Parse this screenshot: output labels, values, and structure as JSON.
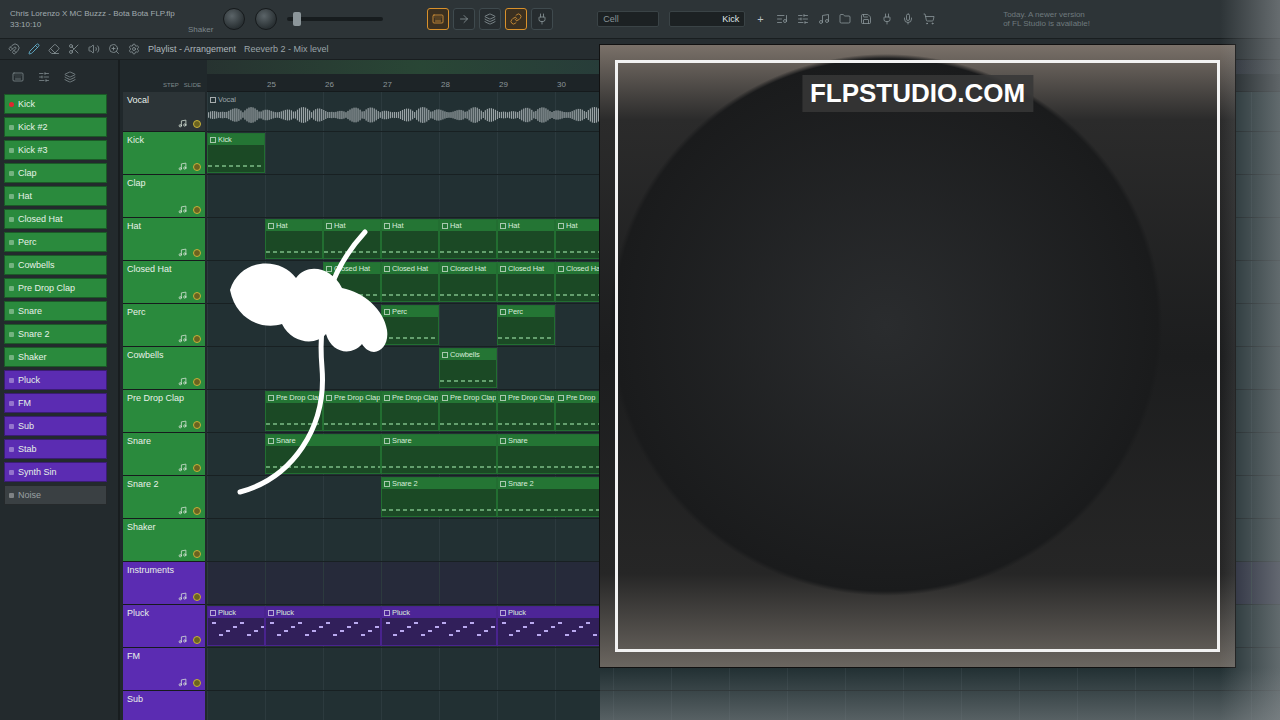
{
  "toolbar": {
    "project_title": "Chris Lorenzo X MC Buzzz - Bota Bota FLP.flp",
    "time": "33:10:10",
    "hint": "Shaker",
    "cell_label": "Cell",
    "pattern": "Kick",
    "add": "+",
    "update_notice": [
      "Today. A newer version",
      "of FL Studio is available!"
    ]
  },
  "playlist_bar": {
    "title": "Playlist - Arrangement",
    "target": "Reeverb 2 - Mix level"
  },
  "snap": {
    "step": "STEP",
    "slide": "SLIDE"
  },
  "channels": [
    {
      "name": "Kick",
      "selected": true,
      "disabled": false,
      "color": "#2a8a3d"
    },
    {
      "name": "Kick #2",
      "selected": false,
      "disabled": false,
      "color": "#2a8a3d"
    },
    {
      "name": "Kick #3",
      "selected": false,
      "disabled": false,
      "color": "#2a8a3d"
    },
    {
      "name": "Clap",
      "selected": false,
      "disabled": false,
      "color": "#2a8a3d"
    },
    {
      "name": "Hat",
      "selected": false,
      "disabled": false,
      "color": "#2a8a3d"
    },
    {
      "name": "Closed Hat",
      "selected": false,
      "disabled": false,
      "color": "#2a8a3d"
    },
    {
      "name": "Perc",
      "selected": false,
      "disabled": false,
      "color": "#2a8a3d"
    },
    {
      "name": "Cowbells",
      "selected": false,
      "disabled": false,
      "color": "#2a8a3d"
    },
    {
      "name": "Pre Drop Clap",
      "selected": false,
      "disabled": false,
      "color": "#2a8a3d"
    },
    {
      "name": "Snare",
      "selected": false,
      "disabled": false,
      "color": "#2a8a3d"
    },
    {
      "name": "Snare  2",
      "selected": false,
      "disabled": false,
      "color": "#2a8a3d"
    },
    {
      "name": "Shaker",
      "selected": false,
      "disabled": false,
      "color": "#2a8a3d"
    },
    {
      "name": "Pluck",
      "selected": false,
      "disabled": false,
      "color": "#5b2cb2"
    },
    {
      "name": "FM",
      "selected": false,
      "disabled": false,
      "color": "#5b2cb2"
    },
    {
      "name": "Sub",
      "selected": false,
      "disabled": false,
      "color": "#5b2cb2"
    },
    {
      "name": "Stab",
      "selected": false,
      "disabled": false,
      "color": "#5b2cb2"
    },
    {
      "name": "Synth Sin",
      "selected": false,
      "disabled": false,
      "color": "#5b2cb2"
    },
    {
      "name": "Noise",
      "selected": false,
      "disabled": true,
      "color": "#3a4043"
    }
  ],
  "ruler": [
    "25",
    "26",
    "27",
    "28",
    "29",
    "30"
  ],
  "tracks": [
    {
      "name": "Vocal",
      "kind": "audio",
      "color": "#2c3437",
      "clips": [
        {
          "label": "Vocal",
          "start": 0,
          "length": 7
        }
      ]
    },
    {
      "name": "Kick",
      "kind": "pattern",
      "color": "#2a8a3d",
      "clips": [
        {
          "label": "Kick",
          "start": 0,
          "length": 1
        }
      ]
    },
    {
      "name": "Clap",
      "kind": "pattern",
      "color": "#2a8a3d",
      "clips": []
    },
    {
      "name": "Hat",
      "kind": "pattern",
      "color": "#2a8a3d",
      "clips": [
        {
          "label": "Hat",
          "start": 1,
          "length": 1
        },
        {
          "label": "Hat",
          "start": 2,
          "length": 1
        },
        {
          "label": "Hat",
          "start": 3,
          "length": 1
        },
        {
          "label": "Hat",
          "start": 4,
          "length": 1
        },
        {
          "label": "Hat",
          "start": 5,
          "length": 1
        },
        {
          "label": "Hat",
          "start": 6,
          "length": 1
        }
      ]
    },
    {
      "name": "Closed Hat",
      "kind": "pattern",
      "color": "#2a8a3d",
      "clips": [
        {
          "label": "Closed Hat",
          "start": 2,
          "length": 1
        },
        {
          "label": "Closed Hat",
          "start": 3,
          "length": 1
        },
        {
          "label": "Closed Hat",
          "start": 4,
          "length": 1
        },
        {
          "label": "Closed Hat",
          "start": 5,
          "length": 1
        },
        {
          "label": "Closed Hat",
          "start": 6,
          "length": 1
        }
      ]
    },
    {
      "name": "Perc",
      "kind": "pattern",
      "color": "#2a8a3d",
      "clips": [
        {
          "label": "Perc",
          "start": 3,
          "length": 1
        },
        {
          "label": "Perc",
          "start": 5,
          "length": 1
        }
      ]
    },
    {
      "name": "Cowbells",
      "kind": "pattern",
      "color": "#2a8a3d",
      "clips": [
        {
          "label": "Cowbells",
          "start": 4,
          "length": 1
        }
      ]
    },
    {
      "name": "Pre Drop Clap",
      "kind": "pattern",
      "color": "#2a8a3d",
      "clips": [
        {
          "label": "Pre Drop Clap",
          "start": 1,
          "length": 1
        },
        {
          "label": "Pre Drop Clap",
          "start": 2,
          "length": 1
        },
        {
          "label": "Pre Drop Clap",
          "start": 3,
          "length": 1
        },
        {
          "label": "Pre Drop Clap",
          "start": 4,
          "length": 1
        },
        {
          "label": "Pre Drop Clap",
          "start": 5,
          "length": 1
        },
        {
          "label": "Pre Drop",
          "start": 6,
          "length": 1
        }
      ]
    },
    {
      "name": "Snare",
      "kind": "pattern",
      "color": "#2a8a3d",
      "clips": [
        {
          "label": "Snare",
          "start": 1,
          "length": 2
        },
        {
          "label": "Snare",
          "start": 3,
          "length": 2
        },
        {
          "label": "Snare",
          "start": 5,
          "length": 2
        }
      ]
    },
    {
      "name": "Snare  2",
      "kind": "pattern",
      "color": "#2a8a3d",
      "clips": [
        {
          "label": "Snare  2",
          "start": 3,
          "length": 2
        },
        {
          "label": "Snare  2",
          "start": 5,
          "length": 2
        }
      ]
    },
    {
      "name": "Shaker",
      "kind": "pattern",
      "color": "#2a8a3d",
      "clips": []
    },
    {
      "name": "Instruments",
      "kind": "folder",
      "color": "#5b2cb2",
      "clips": []
    },
    {
      "name": "Pluck",
      "kind": "notes",
      "color": "#5b2cb2",
      "clips": [
        {
          "label": "Pluck",
          "start": 0,
          "length": 1
        },
        {
          "label": "Pluck",
          "start": 1,
          "length": 2
        },
        {
          "label": "Pluck",
          "start": 3,
          "length": 2
        },
        {
          "label": "Pluck",
          "start": 5,
          "length": 2
        }
      ]
    },
    {
      "name": "FM",
      "kind": "notes",
      "color": "#5b2cb2",
      "clips": []
    },
    {
      "name": "Sub",
      "kind": "notes",
      "color": "#5b2cb2",
      "clips": []
    }
  ],
  "art": {
    "banner": "FLPSTUDIO.COM"
  }
}
